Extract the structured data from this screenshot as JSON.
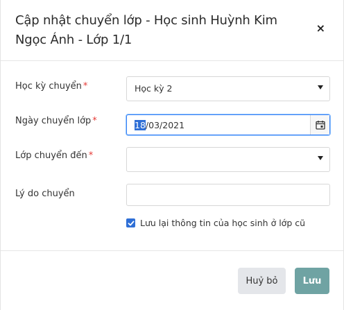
{
  "dialog": {
    "title": "Cập nhật chuyển lớp - Học sinh Huỳnh Kim Ngọc Ánh - Lớp 1/1",
    "close_label": "×"
  },
  "form": {
    "semester": {
      "label": "Học kỳ chuyển",
      "required_mark": "*",
      "value": "Học kỳ 2"
    },
    "transfer_date": {
      "label": "Ngày chuyển lớp",
      "required_mark": "*",
      "value_selected": "18",
      "value_rest": "/03/2021"
    },
    "target_class": {
      "label": "Lớp chuyển đến",
      "required_mark": "*",
      "value": ""
    },
    "reason": {
      "label": "Lý do chuyển",
      "value": ""
    },
    "keep_info": {
      "label": "Lưu lại thông tin của học sinh ở lớp cũ",
      "checked": true
    }
  },
  "footer": {
    "cancel_label": "Huỷ bỏ",
    "save_label": "Lưu"
  },
  "colors": {
    "required": "#e53935",
    "primary": "#2f6fd6",
    "save_button": "#6fa3a3",
    "cancel_button": "#e4e6ea"
  },
  "icons": {
    "close": "close-icon",
    "calendar": "calendar-icon",
    "dropdown": "chevron-down-icon",
    "check": "check-icon"
  }
}
